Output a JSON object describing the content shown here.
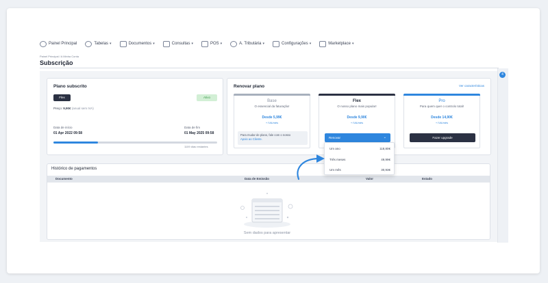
{
  "nav": {
    "items": [
      {
        "label": "Painel Principal",
        "icon": "clock-icon",
        "dropdown": false
      },
      {
        "label": "Tabelas",
        "icon": "users-icon",
        "dropdown": true
      },
      {
        "label": "Documentos",
        "icon": "document-icon",
        "dropdown": true
      },
      {
        "label": "Consultas",
        "icon": "chart-icon",
        "dropdown": true
      },
      {
        "label": "POS",
        "icon": "pos-icon",
        "dropdown": true
      },
      {
        "label": "A. Tributária",
        "icon": "tax-icon",
        "dropdown": true
      },
      {
        "label": "Configurações",
        "icon": "settings-icon",
        "dropdown": true
      },
      {
        "label": "Marketplace",
        "icon": "grid-icon",
        "dropdown": true
      }
    ]
  },
  "breadcrumb": "Painel Principal / A Minha Conta",
  "page_title": "Subscrição",
  "sidebar": {
    "badge": "4"
  },
  "plan": {
    "title": "Plano subscrito",
    "name": "Flex",
    "status": "Ativo",
    "price_prefix": "Preço:",
    "price": "9,90€",
    "price_note": "(anual sem IVA)",
    "start_label": "Data de início",
    "start_value": "01 Apr 2022 09:58",
    "end_label": "Data de fim",
    "end_value": "01 May 2025 09:58",
    "progress": 0.27,
    "days_left": "1109 dias restantes"
  },
  "renew": {
    "title": "Renovar plano",
    "features_link": "Ver características",
    "tiers": [
      {
        "name": "Base",
        "desc": "O essencial da faturação!",
        "price": "Desde 5,99€",
        "vat": "+ IVA/mês",
        "bar_color": "#a7b0bd"
      },
      {
        "name": "Flex",
        "desc": "O nosso plano mais popular!",
        "price": "Desde 9,90€",
        "vat": "+ IVA/mês",
        "bar_color": "#2b3143"
      },
      {
        "name": "Pro",
        "desc": "Para quem quer o controlo total!",
        "price": "Desde 14,90€",
        "vat": "+ IVA/mês",
        "bar_color": "#2e86de"
      }
    ],
    "base_info": "Para mudar de plano, fale com o nosso",
    "base_info_link": "Apoio ao Cliente.",
    "renew_button": "Renovar",
    "upgrade_button": "Fazer upgrade",
    "options": [
      {
        "label": "Um ano",
        "amount": "118,80€"
      },
      {
        "label": "Três meses",
        "amount": "49,99€"
      },
      {
        "label": "Um mês",
        "amount": "30,93€"
      }
    ]
  },
  "history": {
    "title": "Histórico de pagamentos",
    "columns": [
      "Documento",
      "Data de Emissão",
      "Valor",
      "Estado"
    ],
    "empty_text": "Sem dados para apresentar"
  },
  "colors": {
    "accent": "#2e86de",
    "dark": "#2b3143",
    "success_bg": "#d2efd5",
    "success_text": "#3b9a4a"
  }
}
